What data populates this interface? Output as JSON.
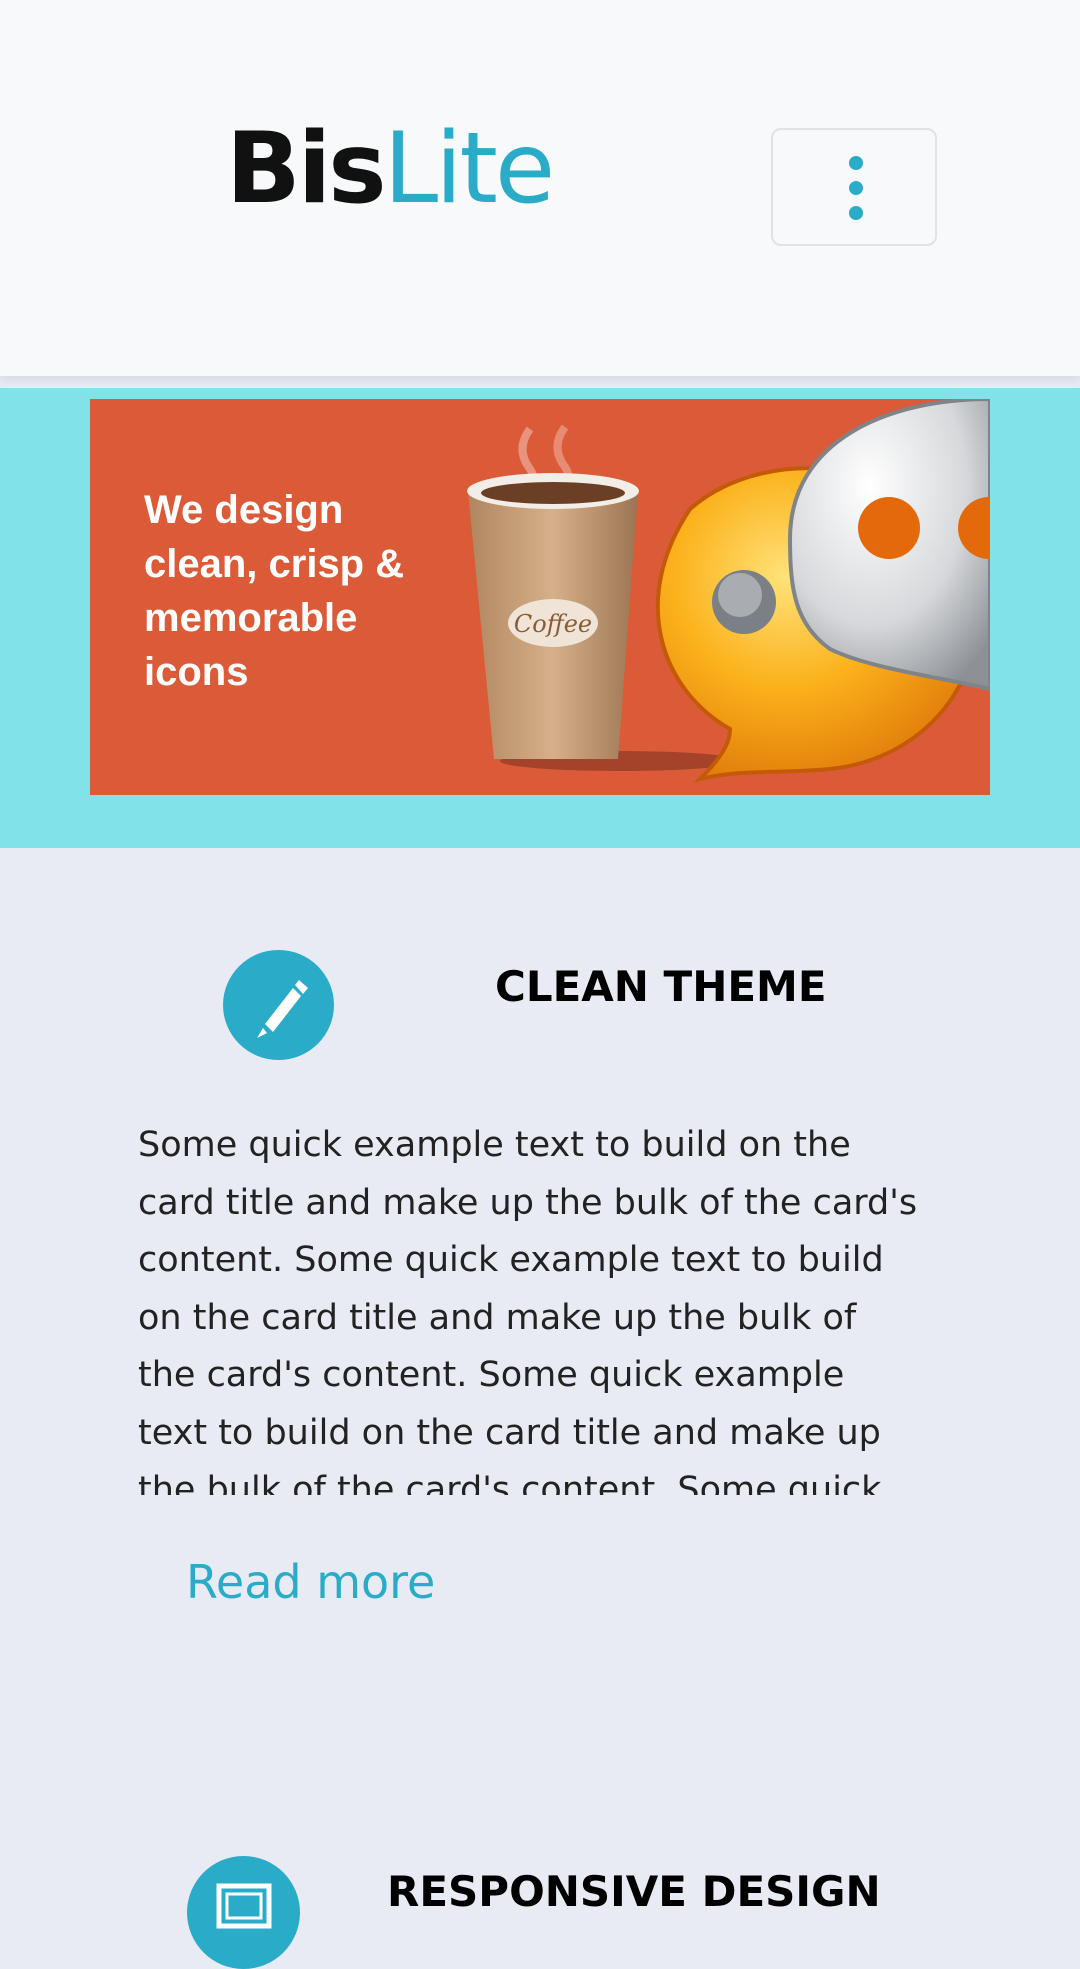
{
  "header": {
    "logo_part1": "Bis",
    "logo_part2": "Lite",
    "menu_icon": "kebab-menu-icon"
  },
  "banner": {
    "text": "We design clean, crisp & memorable icons",
    "cup_label": "Coffee"
  },
  "cards": [
    {
      "title": "CLEAN THEME",
      "icon": "pencil-icon",
      "body": "Some quick example text to build on the card title and make up the bulk of the card's content. Some quick example text to build on the card title and make up the bulk of the card's content. Some quick example text to build on the card title and make up the bulk of the card's content. Some quick",
      "link": "Read more"
    },
    {
      "title": "RESPONSIVE DESIGN",
      "icon": "responsive-screen-icon"
    }
  ],
  "colors": {
    "accent": "#2aacc9",
    "hero_bg": "#81e2ea",
    "banner_bg": "#db5a38",
    "page_bg": "#e8ebf3"
  }
}
